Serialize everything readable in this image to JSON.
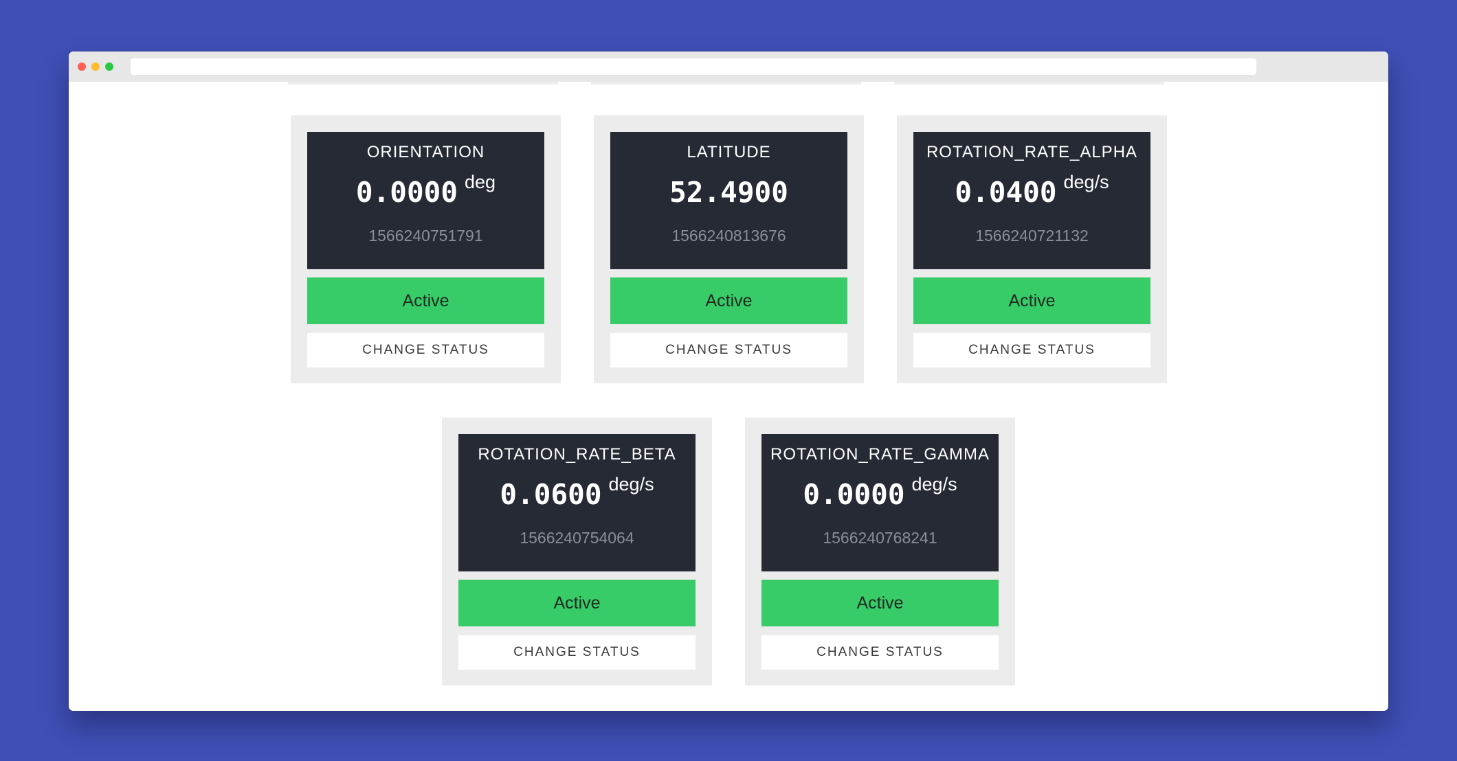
{
  "browser": {
    "address_bar_value": ""
  },
  "colors": {
    "background": "#3f4fb5",
    "panel": "#252a34",
    "active_status": "#37cc68",
    "card": "#ececec"
  },
  "sensors": [
    {
      "name": "ORIENTATION",
      "value": "0.0000",
      "unit": "deg",
      "timestamp": "1566240751791",
      "status": "Active",
      "change_label": "CHANGE STATUS"
    },
    {
      "name": "LATITUDE",
      "value": "52.4900",
      "unit": "",
      "timestamp": "1566240813676",
      "status": "Active",
      "change_label": "CHANGE STATUS"
    },
    {
      "name": "ROTATION_RATE_ALPHA",
      "value": "0.0400",
      "unit": "deg/s",
      "timestamp": "1566240721132",
      "status": "Active",
      "change_label": "CHANGE STATUS"
    },
    {
      "name": "ROTATION_RATE_BETA",
      "value": "0.0600",
      "unit": "deg/s",
      "timestamp": "1566240754064",
      "status": "Active",
      "change_label": "CHANGE STATUS"
    },
    {
      "name": "ROTATION_RATE_GAMMA",
      "value": "0.0000",
      "unit": "deg/s",
      "timestamp": "1566240768241",
      "status": "Active",
      "change_label": "CHANGE STATUS"
    }
  ]
}
